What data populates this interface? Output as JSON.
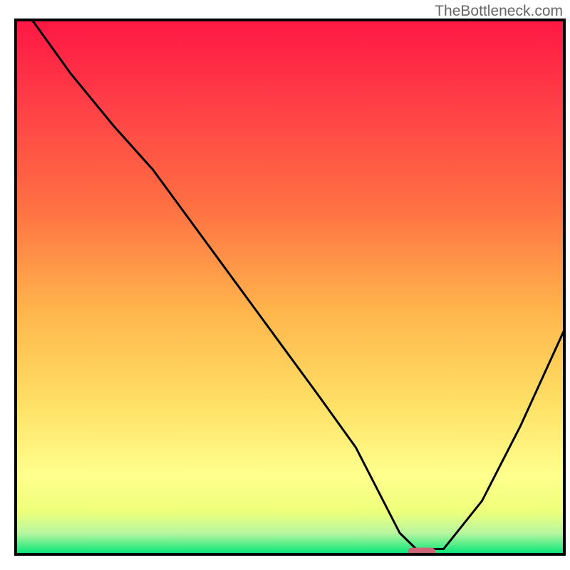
{
  "watermark": "TheBottleneck.com",
  "chart_data": {
    "type": "line",
    "title": "",
    "xlabel": "",
    "ylabel": "",
    "xlim": [
      0,
      100
    ],
    "ylim": [
      0,
      100
    ],
    "background": {
      "type": "vertical_gradient",
      "stops": [
        {
          "offset": 0,
          "color": "#ff1744"
        },
        {
          "offset": 15,
          "color": "#ff3d47"
        },
        {
          "offset": 35,
          "color": "#ff7043"
        },
        {
          "offset": 55,
          "color": "#ffb74d"
        },
        {
          "offset": 72,
          "color": "#ffe066"
        },
        {
          "offset": 85,
          "color": "#ffff8d"
        },
        {
          "offset": 92,
          "color": "#eeff7a"
        },
        {
          "offset": 96,
          "color": "#b9f6a0"
        },
        {
          "offset": 100,
          "color": "#00e676"
        }
      ]
    },
    "series": [
      {
        "name": "bottleneck_curve",
        "color": "#000000",
        "width": 3,
        "x": [
          3,
          10,
          18,
          25,
          35,
          45,
          55,
          62,
          67,
          70,
          73,
          78,
          85,
          92,
          100
        ],
        "y": [
          100,
          90,
          80,
          72,
          58,
          44,
          30,
          20,
          10,
          4,
          1,
          1,
          10,
          24,
          42
        ]
      }
    ],
    "marker": {
      "name": "optimal_point",
      "shape": "rounded_rect",
      "color": "#cc6677",
      "x": 74,
      "y": 0.5,
      "width": 5,
      "height": 1.5
    },
    "frame": {
      "color": "#000000",
      "width": 4
    }
  }
}
